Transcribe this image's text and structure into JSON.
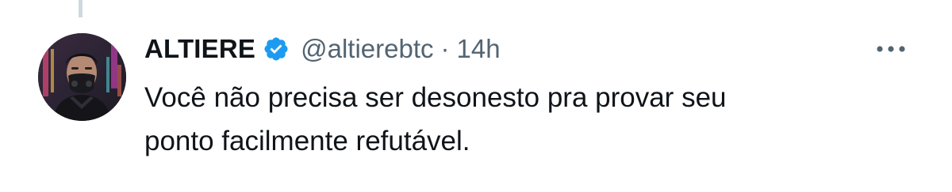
{
  "tweet": {
    "author": {
      "display_name": "ALTIERE",
      "handle": "@altierebtc",
      "verified": true,
      "avatar_icon": "cyberpunk-masked-man-avatar"
    },
    "separator": "·",
    "timestamp": "14h",
    "text_lines": [
      "Você não precisa ser desonesto pra provar seu",
      "ponto facilmente refutável."
    ],
    "more_icon": "more-horizontal-icon",
    "verified_icon": "verified-badge-icon"
  },
  "colors": {
    "primary_text": "#0f1419",
    "secondary_text": "#536471",
    "verified_blue": "#1d9bf0",
    "thread_line": "#cfd9de"
  }
}
